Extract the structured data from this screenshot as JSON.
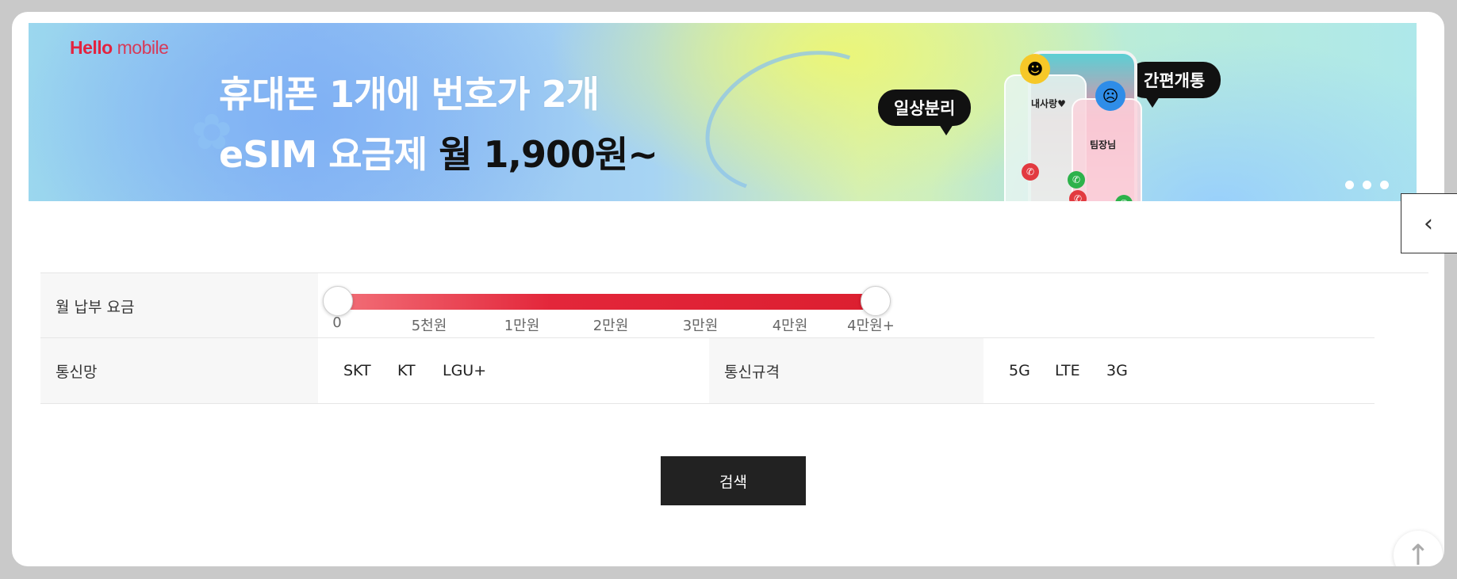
{
  "banner": {
    "logo_part1": "Hello",
    "logo_part2": " mobile",
    "headline_line1": "휴대폰 1개에 번호가 2개",
    "headline_line2_light": "eSIM 요금제 ",
    "headline_line2_dark": "월 1,900원~",
    "bubble_left": "일상분리",
    "bubble_right": "간편개통",
    "phone_label_1": "내사랑♥",
    "phone_label_2": "팀장님",
    "slide_count": 3
  },
  "filter": {
    "monthly_fee_label": "월 납부 요금",
    "slider": {
      "min_fraction": 0,
      "max_fraction": 1,
      "ticks": [
        "0",
        "5천원",
        "1만원",
        "2만원",
        "3만원",
        "4만원",
        "4만원+"
      ]
    },
    "network_label": "통신망",
    "networks": [
      "SKT",
      "KT",
      "LGU+"
    ],
    "standard_label": "통신규격",
    "standards": [
      "5G",
      "LTE",
      "3G"
    ]
  },
  "search_button": "검색",
  "icons": {
    "side_tab": "chevron-left-icon",
    "top_button": "arrow-up-icon"
  },
  "colors": {
    "slider_start": "#f26f78",
    "slider_end": "#dc1f30",
    "logo": "#e3233f",
    "button_bg": "#222222"
  }
}
